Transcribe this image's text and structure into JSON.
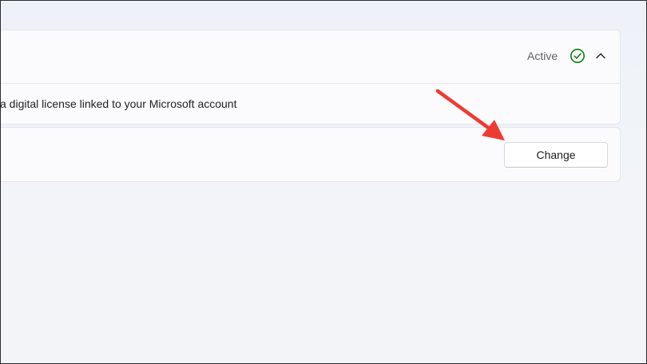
{
  "activation": {
    "status": "Active",
    "status_icon": "check-circle-icon",
    "status_color": "#107c10",
    "expand_icon": "chevron-up-icon",
    "description": "a digital license linked to your Microsoft account"
  },
  "product_key": {
    "change_label": "Change"
  },
  "annotation": {
    "arrow_color": "#ee3b31"
  }
}
